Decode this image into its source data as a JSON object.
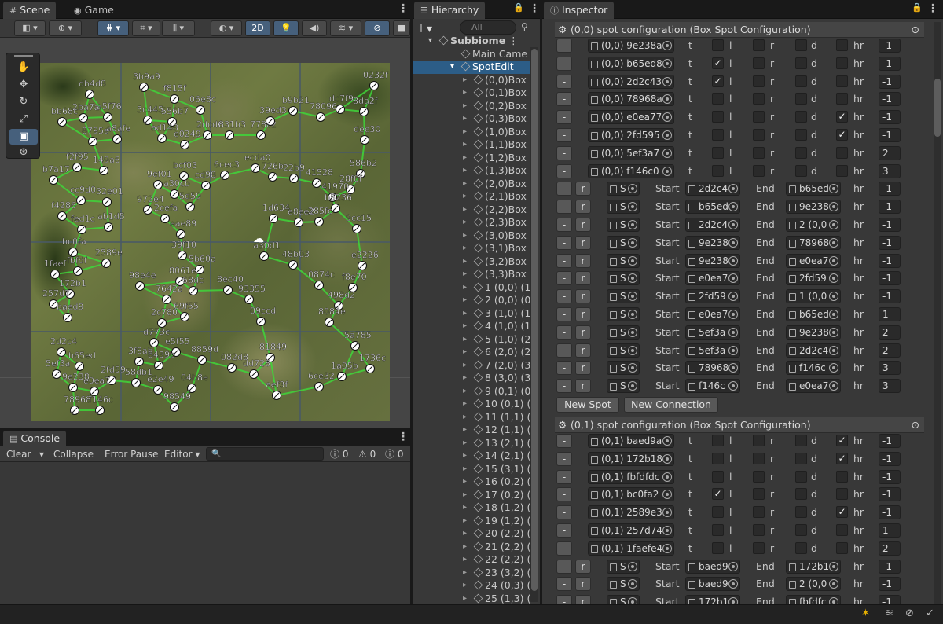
{
  "scene": {
    "tab": "Scene",
    "game_tab": "Game",
    "btn_2d": "2D",
    "labels": [
      [
        "db4d8",
        108,
        106
      ],
      [
        "3b9a9",
        177,
        97
      ],
      [
        "f815f",
        216,
        112
      ],
      [
        "0232f",
        470,
        95
      ],
      [
        "bb68c",
        73,
        141
      ],
      [
        "2ba7a",
        100,
        136
      ],
      [
        "a5f76",
        131,
        135
      ],
      [
        "5c445",
        182,
        139
      ],
      [
        "556b7",
        213,
        141
      ],
      [
        "06e8c",
        249,
        126
      ],
      [
        "b9b21",
        367,
        127
      ],
      [
        "dc7f9",
        427,
        125
      ],
      [
        "8da2f",
        457,
        128
      ],
      [
        "8795a",
        112,
        166
      ],
      [
        "a8afe",
        143,
        163
      ],
      [
        "ad148",
        200,
        162
      ],
      [
        "2dcd6",
        258,
        158
      ],
      [
        "831b3",
        286,
        158
      ],
      [
        "778c2",
        326,
        158
      ],
      [
        "39ed3",
        338,
        140
      ],
      [
        "78096",
        402,
        135
      ],
      [
        "dee30",
        458,
        164
      ],
      [
        "e0249",
        229,
        170
      ],
      [
        "f2f95",
        92,
        199
      ],
      [
        "149a6",
        126,
        203
      ],
      [
        "ecda0",
        319,
        200
      ],
      [
        "b7a17",
        62,
        215
      ],
      [
        "bcf03",
        228,
        210
      ],
      [
        "9ef01",
        195,
        221
      ],
      [
        "6cec3",
        280,
        209
      ],
      [
        "726b",
        341,
        211
      ],
      [
        "22b9",
        368,
        213
      ],
      [
        "41528",
        397,
        219
      ],
      [
        "586b2",
        453,
        207
      ],
      [
        "28f0f",
        440,
        227
      ],
      [
        "a30cb",
        216,
        233
      ],
      [
        "cd98",
        256,
        222
      ],
      [
        "cc9d0",
        97,
        241
      ],
      [
        "32e01",
        130,
        243
      ],
      [
        "41970",
        417,
        237
      ],
      [
        "b5236",
        421,
        251
      ],
      [
        "972e4",
        182,
        253
      ],
      [
        "5d59",
        236,
        249
      ],
      [
        "f4286",
        73,
        261
      ],
      [
        "2cefa",
        204,
        264
      ],
      [
        "1d634",
        342,
        264
      ],
      [
        "e8ee2",
        374,
        269
      ],
      [
        "285fc",
        400,
        268
      ],
      [
        "9cc15",
        448,
        277
      ],
      [
        "fed1c",
        98,
        278
      ],
      [
        "ab1d5",
        132,
        275
      ],
      [
        "eae89",
        224,
        284
      ],
      [
        "bc0fa",
        87,
        307
      ],
      [
        "39f10",
        226,
        311
      ],
      [
        "a30d1",
        330,
        312
      ],
      [
        "48b03",
        367,
        323
      ],
      [
        "e2226",
        455,
        324
      ],
      [
        "1faef",
        64,
        335
      ],
      [
        "fbfdf",
        93,
        331
      ],
      [
        "2589e",
        129,
        321
      ],
      [
        "5b60a",
        248,
        329
      ],
      [
        "8061e",
        223,
        344
      ],
      [
        "98e4e",
        172,
        350
      ],
      [
        "68dc",
        240,
        356
      ],
      [
        "0874c",
        400,
        349
      ],
      [
        "f8e70",
        443,
        352
      ],
      [
        "172b1",
        83,
        360
      ],
      [
        "257d7",
        62,
        373
      ],
      [
        "8ec40",
        284,
        355
      ],
      [
        "7642a",
        206,
        367
      ],
      [
        "93355",
        311,
        367
      ],
      [
        "498d2",
        425,
        375
      ],
      [
        "baed9",
        80,
        390
      ],
      [
        "69f55",
        229,
        389
      ],
      [
        "2c780",
        200,
        397
      ],
      [
        "09ccd",
        326,
        395
      ],
      [
        "8084e",
        413,
        396
      ],
      [
        "d773c",
        190,
        422
      ],
      [
        "e5f55",
        218,
        434
      ],
      [
        "5a785",
        446,
        426
      ],
      [
        "2d2c4",
        72,
        434
      ],
      [
        "3f8ab",
        171,
        446
      ],
      [
        "8859d",
        251,
        444
      ],
      [
        "81849",
        338,
        441
      ],
      [
        "b65ed",
        95,
        452
      ],
      [
        "8439b",
        196,
        451
      ],
      [
        "082d8",
        289,
        454
      ],
      [
        "dd728",
        317,
        462
      ],
      [
        "1736c",
        465,
        455
      ],
      [
        "5ef3a",
        66,
        462
      ],
      [
        "2fd59",
        136,
        470
      ],
      [
        "58db1",
        167,
        473
      ],
      [
        "1a05b",
        429,
        465
      ],
      [
        "9e238",
        87,
        479
      ],
      [
        "e2e49",
        195,
        482
      ],
      [
        "04b8e",
        238,
        480
      ],
      [
        "6ce32",
        400,
        478
      ],
      [
        "e0ea7",
        114,
        484
      ],
      [
        "aef3f",
        346,
        489
      ],
      [
        "78968",
        89,
        508
      ],
      [
        "f146c",
        121,
        508
      ],
      [
        "98549",
        216,
        504
      ]
    ]
  },
  "console": {
    "tab": "Console",
    "clear": "Clear",
    "collapse": "Collapse",
    "error_pause": "Error Pause",
    "editor": "Editor",
    "c1": "0",
    "c2": "0",
    "c3": "0"
  },
  "hierarchy": {
    "tab": "Hierarchy",
    "search_placeholder": "All",
    "items": [
      "Subbiome",
      "Main Came",
      "SpotEdit",
      "(0,0)Box",
      "(0,1)Box",
      "(0,2)Box",
      "(0,3)Box",
      "(1,0)Box",
      "(1,1)Box",
      "(1,2)Box",
      "(1,3)Box",
      "(2,0)Box",
      "(2,1)Box",
      "(2,2)Box",
      "(2,3)Box",
      "(3,0)Box",
      "(3,1)Box",
      "(3,2)Box",
      "(3,3)Box",
      "1 (0,0) (1,",
      "2 (0,0) (0,",
      "3 (1,0) (1,",
      "4 (1,0) (1,",
      "5 (1,0) (2,",
      "6 (2,0) (2,",
      "7 (2,0) (3,",
      "8 (3,0) (3,",
      "9 (0,1) (0,",
      "10 (0,1) (",
      "11 (1,1) (",
      "12 (1,1) (",
      "13 (2,1) (",
      "14 (2,1) (",
      "15 (3,1) (",
      "16 (0,2) (",
      "17 (0,2) (",
      "18 (1,2) (",
      "19 (1,2) (",
      "20 (2,2) (",
      "21 (2,2) (",
      "22 (2,2) (",
      "23 (3,2) (",
      "24 (0,3) (",
      "25 (1,3) ("
    ]
  },
  "inspector": {
    "tab": "Inspector",
    "section1": "(0,0) spot configuration (Box Spot Configuration)",
    "section2": "(0,1) spot configuration (Box Spot Configuration)",
    "minus": "-",
    "r": "r",
    "t": "t",
    "l": "l",
    "rr": "r",
    "d": "d",
    "hr": "hr",
    "start": "Start",
    "end": "End",
    "s": "S",
    "new_spot": "New Spot",
    "new_connection": "New Connection",
    "spots1": [
      {
        "name": "(0,0) 9e238a",
        "t": false,
        "l": false,
        "r": false,
        "d": false,
        "hr": "-1"
      },
      {
        "name": "(0,0) b65ed8",
        "t": true,
        "l": false,
        "r": false,
        "d": false,
        "hr": "-1"
      },
      {
        "name": "(0,0) 2d2c43",
        "t": true,
        "l": false,
        "r": false,
        "d": false,
        "hr": "-1"
      },
      {
        "name": "(0,0) 78968a",
        "t": false,
        "l": false,
        "r": false,
        "d": false,
        "hr": "-1"
      },
      {
        "name": "(0,0) e0ea77",
        "t": false,
        "l": false,
        "r": false,
        "d": true,
        "hr": "-1"
      },
      {
        "name": "(0,0) 2fd595",
        "t": false,
        "l": false,
        "r": false,
        "d": true,
        "hr": "-1"
      },
      {
        "name": "(0,0) 5ef3a7",
        "t": false,
        "l": false,
        "r": false,
        "d": false,
        "hr": "2"
      },
      {
        "name": "(0,0) f146c0",
        "t": false,
        "l": false,
        "r": false,
        "d": false,
        "hr": "3"
      }
    ],
    "conns1": [
      {
        "start": "2d2c4",
        "end": "b65ed",
        "hr": "-1"
      },
      {
        "start": "b65ed",
        "end": "9e238",
        "hr": "-1"
      },
      {
        "start": "2d2c4",
        "end": "2 (0,0",
        "hr": "-1"
      },
      {
        "start": "9e238",
        "end": "78968",
        "hr": "-1"
      },
      {
        "start": "9e238",
        "end": "e0ea7",
        "hr": "-1"
      },
      {
        "start": "e0ea7",
        "end": "2fd59",
        "hr": "-1"
      },
      {
        "start": "2fd59",
        "end": "1 (0,0",
        "hr": "-1"
      },
      {
        "start": "e0ea7",
        "end": "b65ed",
        "hr": "1"
      },
      {
        "start": "5ef3a",
        "end": "9e238",
        "hr": "2"
      },
      {
        "start": "5ef3a",
        "end": "2d2c4",
        "hr": "2"
      },
      {
        "start": "78968",
        "end": "f146c",
        "hr": "3"
      },
      {
        "start": "f146c",
        "end": "e0ea7",
        "hr": "3"
      }
    ],
    "spots2": [
      {
        "name": "(0,1) baed9a",
        "t": false,
        "l": false,
        "r": false,
        "d": true,
        "hr": "-1"
      },
      {
        "name": "(0,1) 172b18",
        "t": false,
        "l": false,
        "r": false,
        "d": true,
        "hr": "-1"
      },
      {
        "name": "(0,1) fbfdfdc",
        "t": false,
        "l": false,
        "r": false,
        "d": false,
        "hr": "-1"
      },
      {
        "name": "(0,1) bc0fa2",
        "t": true,
        "l": false,
        "r": false,
        "d": false,
        "hr": "-1"
      },
      {
        "name": "(0,1) 2589e3",
        "t": false,
        "l": false,
        "r": false,
        "d": true,
        "hr": "-1"
      },
      {
        "name": "(0,1) 257d74",
        "t": false,
        "l": false,
        "r": false,
        "d": false,
        "hr": "1"
      },
      {
        "name": "(0,1) 1faefe4",
        "t": false,
        "l": false,
        "r": false,
        "d": false,
        "hr": "2"
      }
    ],
    "conns2": [
      {
        "start": "baed9",
        "end": "172b1",
        "hr": "-1"
      },
      {
        "start": "baed9",
        "end": "2 (0,0",
        "hr": "-1"
      },
      {
        "start": "172b1",
        "end": "fbfdfc",
        "hr": "-1"
      }
    ]
  }
}
